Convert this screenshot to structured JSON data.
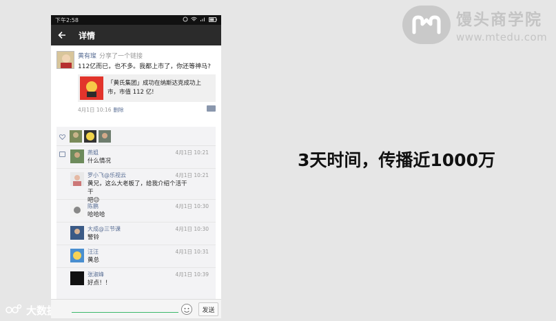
{
  "brand": {
    "name": "馒头商学院",
    "url": "www.mtedu.com"
  },
  "headline": "3天时间，传播近1000万",
  "watermark": "大数据说",
  "phone": {
    "status_time": "下午2:58",
    "title": "详情",
    "post": {
      "author": "黄有璨",
      "action": "分享了一个链接",
      "text": "112亿而已，也不多。我都上市了，你还等神马?",
      "share_text_line1": "「黄氏集团」成功在纳斯达克成功上",
      "share_text_line2": "市，市值 112 亿!",
      "time": "4月1日 10:16",
      "delete_label": "删除"
    },
    "comments": [
      {
        "name": "燕姐",
        "time": "4月1日 10:21",
        "text": "什么情况"
      },
      {
        "name": "罗小飞@乐视云",
        "time": "4月1日 10:21",
        "text": "黄兄，这么大老板了，给我介绍个活干干",
        "text2": "吧😉"
      },
      {
        "name": "陈鹏",
        "time": "4月1日 10:30",
        "text": "哈哈哈"
      },
      {
        "name": "大成@三节课",
        "time": "4月1日 10:30",
        "text": "警铃"
      },
      {
        "name": "汪汪",
        "time": "4月1日 10:31",
        "text": "黄总"
      },
      {
        "name": "张淑峰",
        "time": "4月1日 10:39",
        "text": "好点！！"
      }
    ],
    "send_label": "发送"
  },
  "colors": {
    "accent_link": "#5a6f95",
    "titlebar": "#2b2b2b",
    "input_line": "#39b86a"
  }
}
